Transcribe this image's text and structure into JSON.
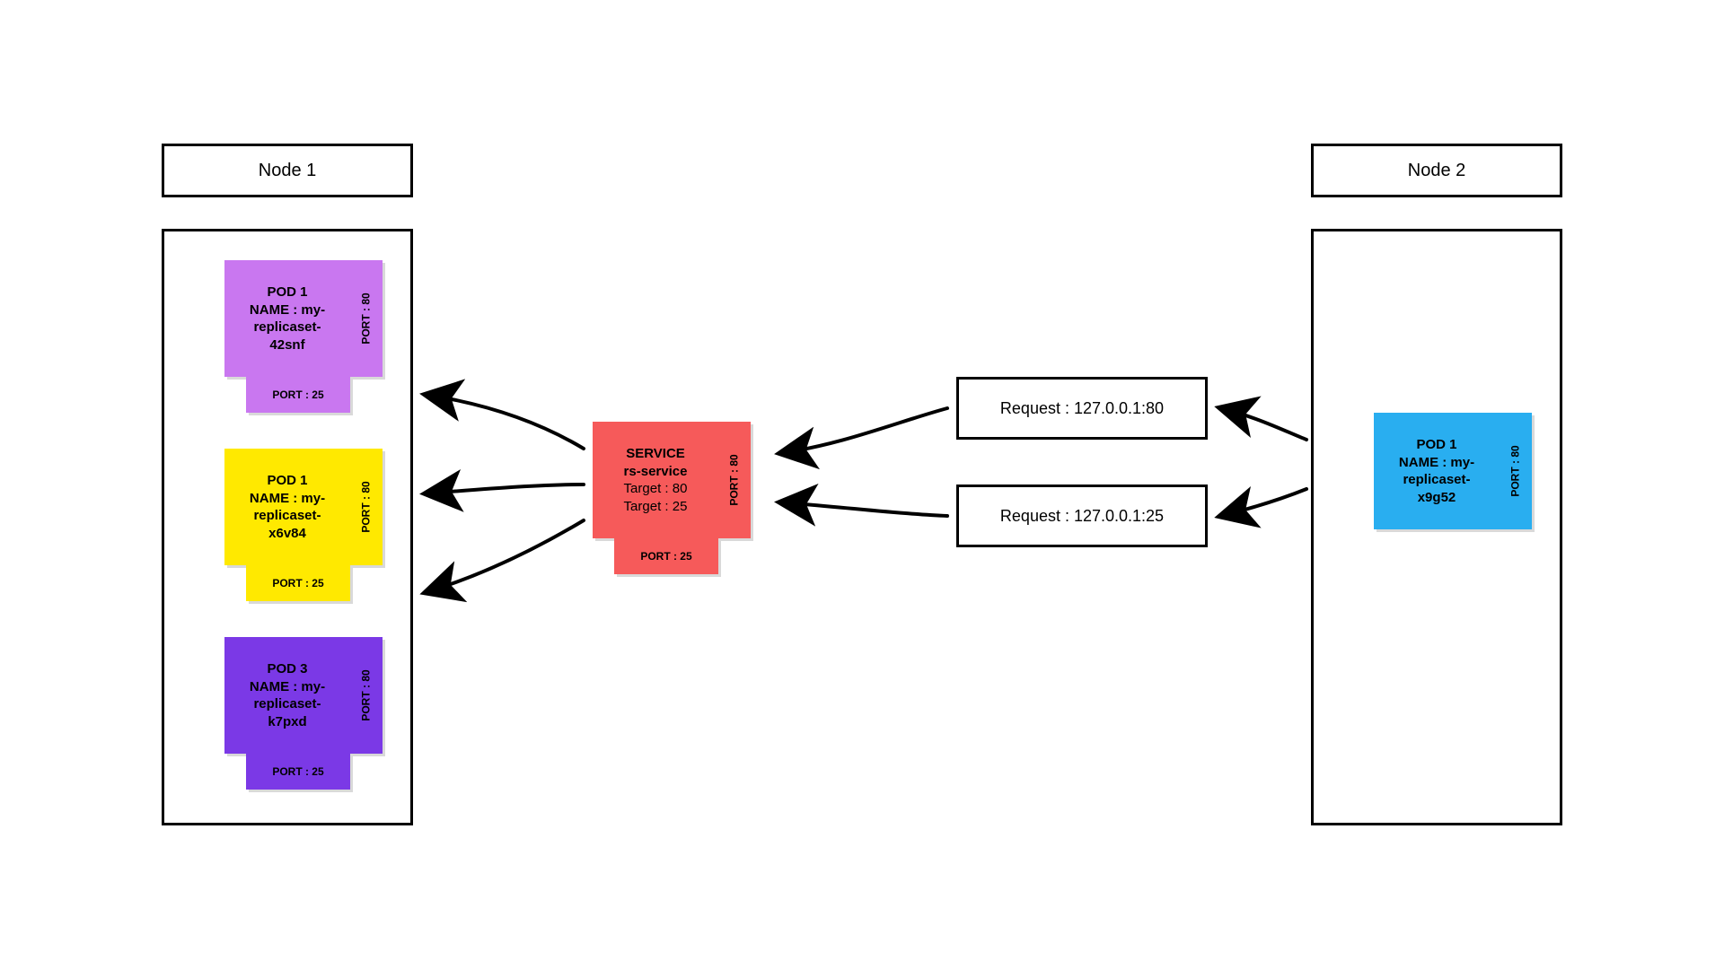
{
  "node1": {
    "title": "Node 1",
    "pods": [
      {
        "title": "POD 1",
        "nameLabel": "NAME : my-",
        "nameLine2": "replicaset-",
        "nameLine3": "42snf",
        "portRight": "PORT : 80",
        "portBottom": "PORT : 25"
      },
      {
        "title": "POD 1",
        "nameLabel": "NAME : my-",
        "nameLine2": "replicaset-",
        "nameLine3": "x6v84",
        "portRight": "PORT : 80",
        "portBottom": "PORT : 25"
      },
      {
        "title": "POD 3",
        "nameLabel": "NAME : my-",
        "nameLine2": "replicaset-",
        "nameLine3": "k7pxd",
        "portRight": "PORT : 80",
        "portBottom": "PORT : 25"
      }
    ]
  },
  "service": {
    "title": "SERVICE",
    "name": "rs-service",
    "target1": "Target : 80",
    "target2": "Target : 25",
    "portRight": "PORT : 80",
    "portBottom": "PORT : 25"
  },
  "requests": [
    {
      "label": "Request : 127.0.0.1:80"
    },
    {
      "label": "Request : 127.0.0.1:25"
    }
  ],
  "node2": {
    "title": "Node 2",
    "pod": {
      "title": "POD 1",
      "nameLabel": "NAME : my-",
      "nameLine2": "replicaset-",
      "nameLine3": "x9g52",
      "portRight": "PORT : 80"
    }
  },
  "colors": {
    "purpleLight": "#c977f0",
    "yellow": "#ffe900",
    "purpleDark": "#7b39e6",
    "red": "#f65a5a",
    "blue": "#29aef0"
  }
}
